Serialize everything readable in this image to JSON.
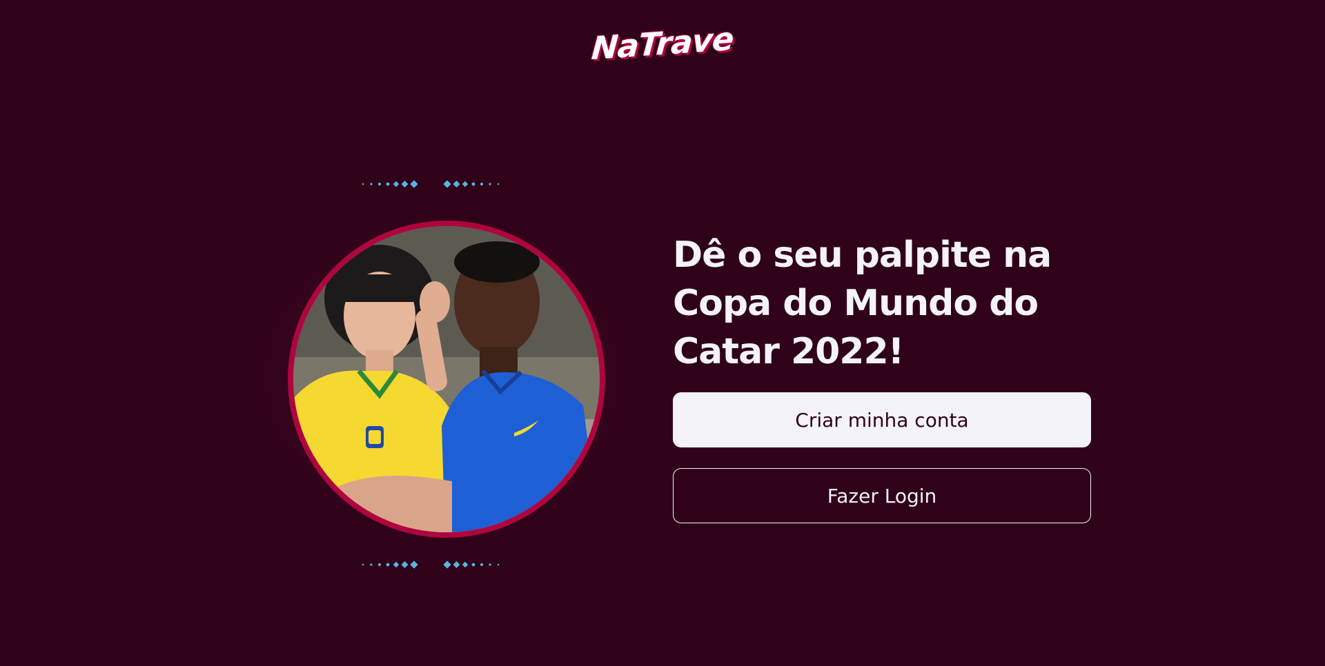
{
  "brand": {
    "logo_text": "NaTrave",
    "logo_color": "#ffffff",
    "logo_accent": "#af053f"
  },
  "colors": {
    "background": "#300219",
    "accent_red": "#af053f",
    "dots_blue": "#5bb3e0",
    "light": "#f4f3fa"
  },
  "hero": {
    "image_icon": "people-photo"
  },
  "main": {
    "headline": "Dê o seu palpite na Copa do Mundo do Catar 2022!",
    "create_account_label": "Criar minha conta",
    "login_label": "Fazer Login"
  }
}
